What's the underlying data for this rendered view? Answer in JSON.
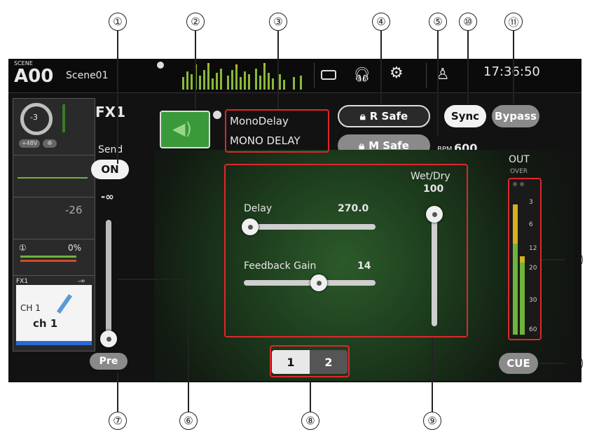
{
  "callouts": [
    "①",
    "②",
    "③",
    "④",
    "⑤",
    "⑩",
    "⑪",
    "⑫",
    "⑬",
    "⑥",
    "⑦",
    "⑧",
    "⑨"
  ],
  "topbar": {
    "scene_label": "SCENE",
    "scene_number": "A00",
    "scene_name": "Scene01",
    "time": "17:36:50"
  },
  "channel_strip": {
    "gain_value": "-3",
    "phantom_label": "+48V",
    "phase_label": "Φ",
    "level_value": "-26",
    "send_percent": "0%",
    "fx_label": "FX1",
    "fx_value": "-∞",
    "channel_number": "CH 1",
    "channel_name": "ch 1"
  },
  "effect": {
    "title": "FX1",
    "type_name": "MonoDelay",
    "preset_name": "MONO DELAY"
  },
  "send": {
    "label": "Send",
    "on_label": "ON",
    "level": "-∞",
    "pre_label": "Pre",
    "fader_level": 0.0
  },
  "safe": {
    "recall_label": "R Safe",
    "mute_label": "M Safe"
  },
  "sync": {
    "sync_label": "Sync",
    "bypass_label": "Bypass",
    "bpm_label": "BPM",
    "bpm_value": "600"
  },
  "params": {
    "delay_label": "Delay",
    "delay_value": "270.0",
    "delay_level": 0.05,
    "feedback_label": "Feedback Gain",
    "feedback_value": "14",
    "feedback_level": 0.57,
    "wetdry_label": "Wet/Dry",
    "wetdry_value": "100",
    "wetdry_level": 1.0
  },
  "pages": [
    "1",
    "2"
  ],
  "output": {
    "label": "OUT",
    "over_label": "OVER",
    "scale": [
      "3",
      "6",
      "12",
      "20",
      "30",
      "60"
    ],
    "cue_label": "CUE"
  },
  "colors": {
    "accent_red": "#e0262c",
    "fx_green": "#3a9a3a",
    "meter_green": "#6fb43a",
    "meter_yellow": "#d6b020"
  },
  "icons": [
    "speaker-icon",
    "edit-icon",
    "lock-icon",
    "headphones-icon",
    "gear-icon",
    "user-icon",
    "recorder-icon"
  ]
}
